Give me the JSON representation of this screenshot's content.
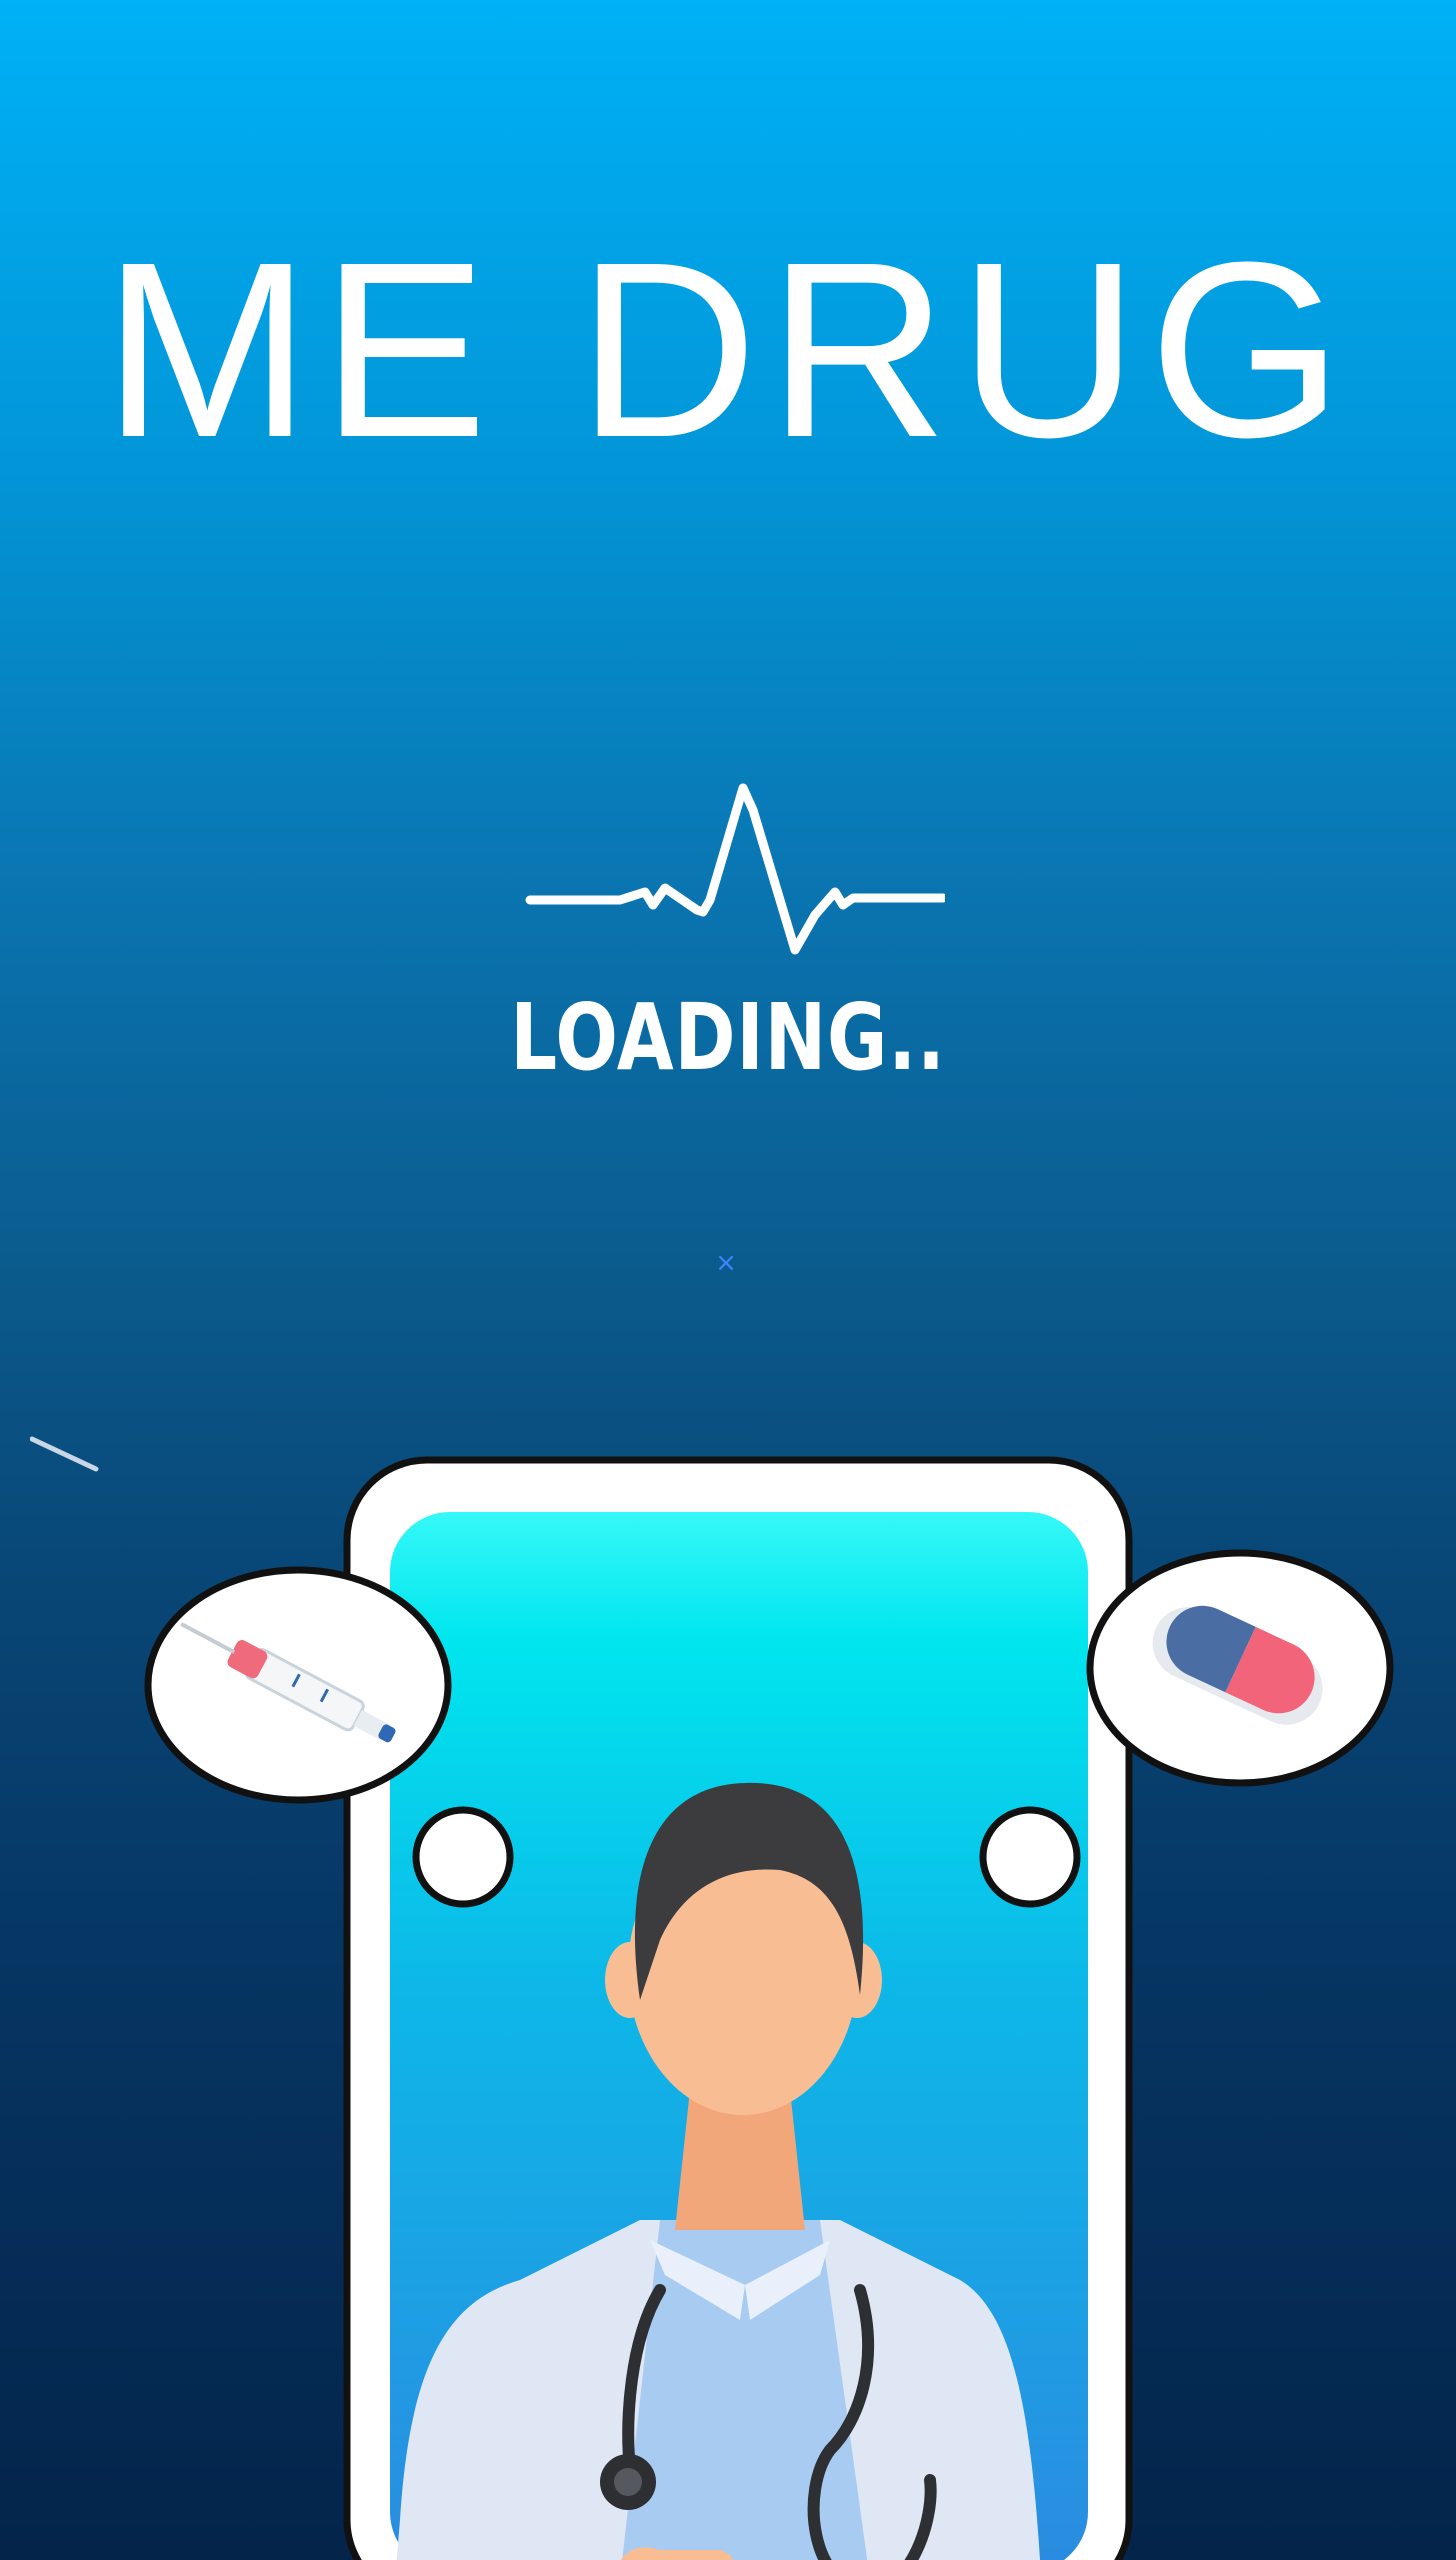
{
  "app": {
    "title": "ME DRUG",
    "loading_text": "LOADING..",
    "close_glyph": "×"
  },
  "icons": {
    "heartbeat": "heartbeat-pulse-icon",
    "syringe": "syringe-icon",
    "capsule": "capsule-pill-icon",
    "doctor": "doctor-illustration"
  },
  "colors": {
    "background_top": "#00b1f6",
    "background_bottom": "#04244a",
    "text": "#ffffff",
    "close_icon": "#3f83ff",
    "phone_screen_top": "#35f8f8",
    "phone_screen_bottom": "#2b8be0"
  }
}
